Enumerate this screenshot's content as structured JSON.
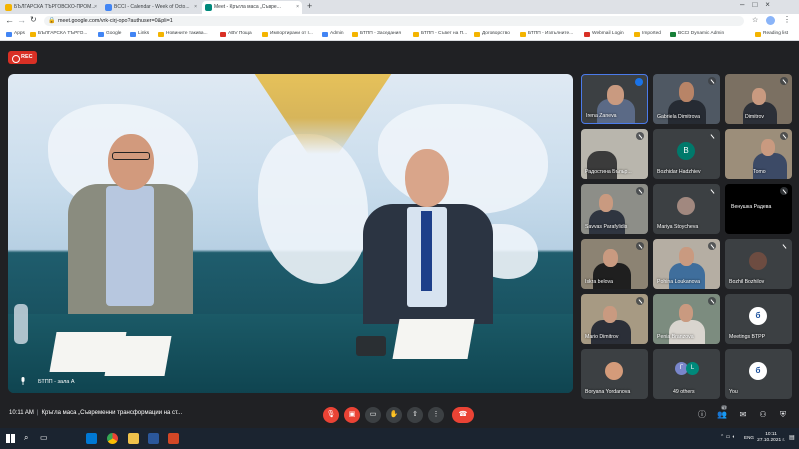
{
  "browser": {
    "tabs": [
      {
        "label": "БЪЛГАРСКА ТЪРГОВСКО-ПРОМ...",
        "active": false,
        "favicon_color": "#f4b400"
      },
      {
        "label": "BCCI - Calendar - Week of Octo...",
        "active": false,
        "favicon_color": "#4285f4"
      },
      {
        "label": "Meet - Кръгла маса „Съвре...",
        "active": true,
        "favicon_color": "#00897b"
      }
    ],
    "new_tab": "+",
    "url": "meet.google.com/vrk-cirj-opo?authuser=0&pli=1",
    "bookmarks": [
      "Apps",
      "БЪЛГАРСКА ТЪРГО...",
      "Google",
      "Links",
      "Новините такива...",
      "ABV Поща",
      "Импортирани от I...",
      "Admin",
      "БТПП - Заседания",
      "БТПП - Съвет на П...",
      "Договорство",
      "БТПП - Изпълните...",
      "Webmail Login",
      "Imported",
      "BCCI Dynamic Admin",
      "Reading list"
    ]
  },
  "meet": {
    "rec_label": "REC",
    "main_label": "БТПП - зала А",
    "participants": [
      {
        "name": "Irena Zaneva",
        "avatar": ""
      },
      {
        "name": "Gabriela Dimitrova",
        "avatar": ""
      },
      {
        "name": "Dimitrov",
        "avatar": ""
      },
      {
        "name": "Радостина Бъльр...",
        "avatar": ""
      },
      {
        "name": "Bozhidar Hadzhiev",
        "avatar": "B"
      },
      {
        "name": "Tomo",
        "avatar": ""
      },
      {
        "name": "Savvas Parafylidis",
        "avatar": ""
      },
      {
        "name": "Mariya Stoycheva",
        "avatar": ""
      },
      {
        "name": "Венушка Радева",
        "avatar": ""
      },
      {
        "name": "Iskra belova",
        "avatar": ""
      },
      {
        "name": "Pohina Loukanova",
        "avatar": ""
      },
      {
        "name": "Bozhil Bozhilov",
        "avatar": ""
      },
      {
        "name": "Mario Dimitrov",
        "avatar": ""
      },
      {
        "name": "Penia Branzova",
        "avatar": ""
      },
      {
        "name": "Meetings BTPP",
        "avatar": ""
      },
      {
        "name": "Boryana Yordanova",
        "avatar": ""
      },
      {
        "name": "49 others",
        "avatar": "Г L"
      },
      {
        "name": "You",
        "avatar": ""
      }
    ],
    "bottom": {
      "time": "10:11 AM",
      "meeting_title": "Кръгла маса „Съвременни трансформации на ст...",
      "people_count": "67"
    }
  },
  "taskbar": {
    "language": "ENG",
    "time": "10:11",
    "date": "27.10.2021 г."
  },
  "colors": {
    "accent_red": "#ea4335",
    "meet_bg": "#202124",
    "tile_bg": "#3c4043"
  }
}
